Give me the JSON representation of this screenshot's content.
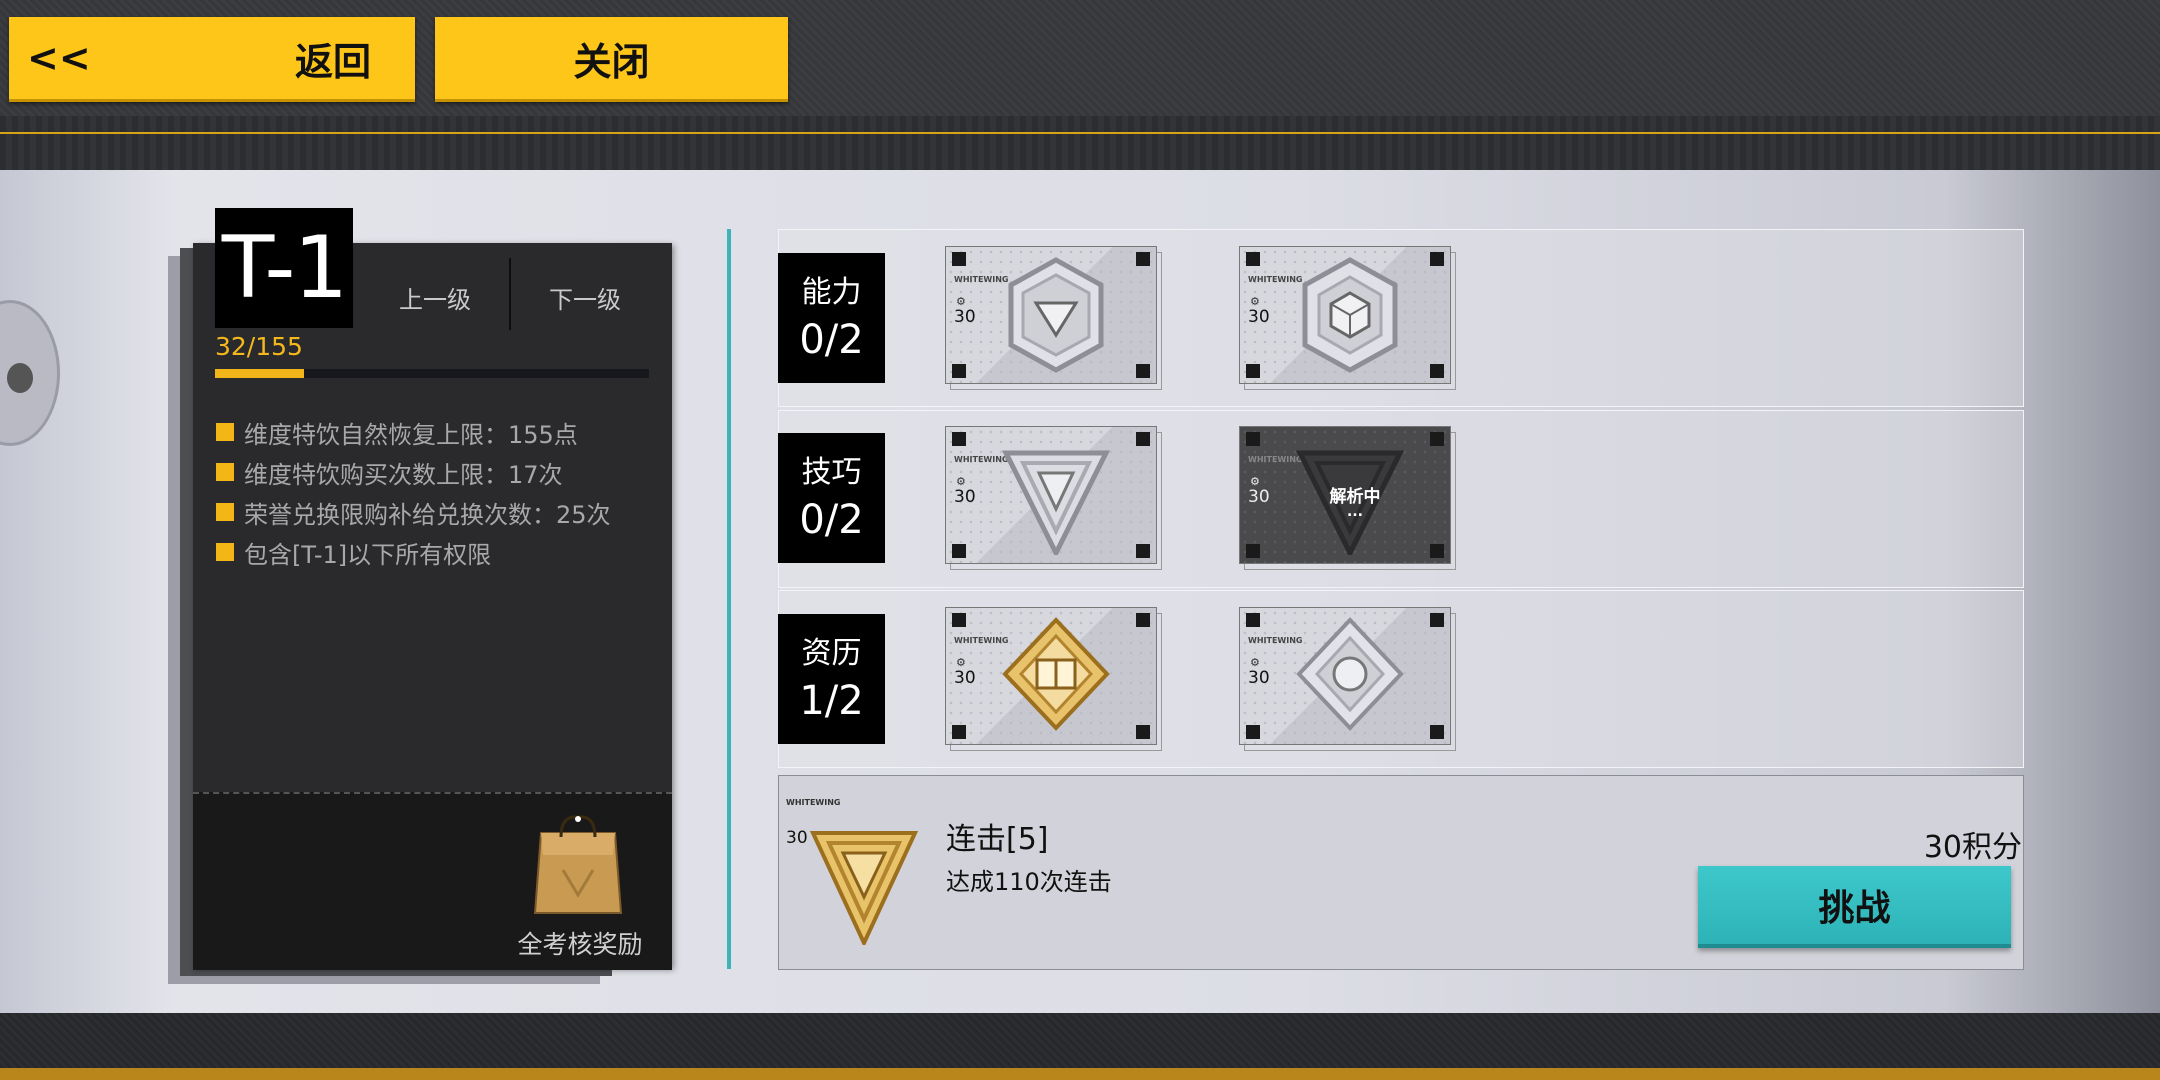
{
  "header": {
    "back_arrows": "<<",
    "back_label": "返回",
    "close_label": "关闭"
  },
  "tier": {
    "name": "T-1",
    "prev_label": "上一级",
    "next_label": "下一级",
    "progress_text": "32/155",
    "progress_fraction": 0.206
  },
  "perks": [
    "维度特饮自然恢复上限：155点",
    "维度特饮购买次数上限：17次",
    "荣誉兑换限购补给兑换次数：25次",
    "包含[T-1]以下所有权限"
  ],
  "reward": {
    "label": "全考核奖励"
  },
  "categories": [
    {
      "name": "能力",
      "count": "0/2"
    },
    {
      "name": "技巧",
      "count": "0/2"
    },
    {
      "name": "资历",
      "count": "1/2"
    }
  ],
  "cards": {
    "brand": "WHITEWING",
    "points": "30",
    "analyzing": "解析中",
    "analyzing_dots": "..."
  },
  "challenge": {
    "title": "连击[5]",
    "desc": "达成110次连击",
    "score": "30积分",
    "button_label": "挑战"
  },
  "colors": {
    "accent_yellow": "#ffc61a",
    "accent_teal": "#3bb3b8",
    "gold": "#d4a33a"
  }
}
